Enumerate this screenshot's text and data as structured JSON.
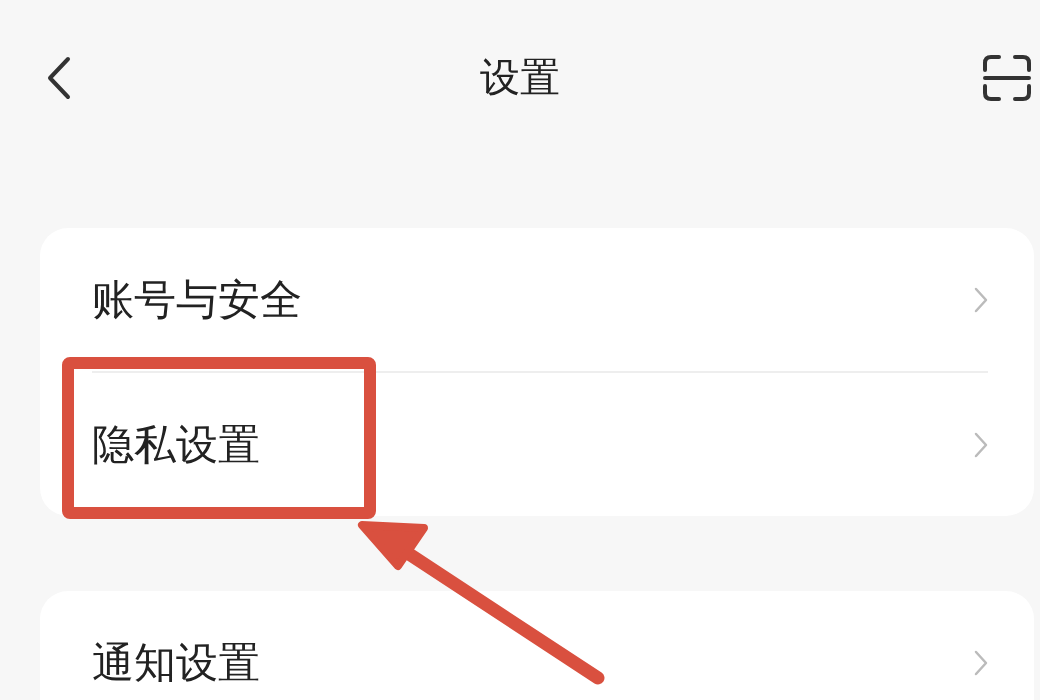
{
  "header": {
    "title": "设置"
  },
  "groups": [
    {
      "items": [
        {
          "label": "账号与安全",
          "highlighted": false
        },
        {
          "label": "隐私设置",
          "highlighted": true
        }
      ]
    },
    {
      "items": [
        {
          "label": "通知设置",
          "highlighted": false
        }
      ]
    }
  ]
}
